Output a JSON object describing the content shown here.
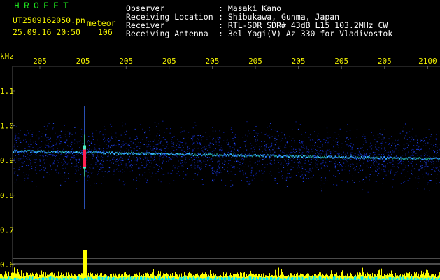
{
  "header": {
    "logo": "HROFFT",
    "filename": "UT2509162050.pn",
    "mode": "meteor",
    "datetime": "25.09.16 20:50",
    "count": "106",
    "info_labels": [
      "Observer",
      "Receiving Location",
      "Receiver",
      "Receiving Antenna"
    ],
    "info_values": [
      ": Masaki Kano",
      ": Shibukawa, Gunma, Japan",
      ": RTL-SDR SDR# 43dB L15 103.2MHz CW",
      ": 3el Yagi(V) Az 330 for Vladivostok"
    ]
  },
  "axis": {
    "unit": "kHz",
    "y_ticks": [
      "1.1",
      "1.0",
      "0.9",
      "0.8",
      "0.7",
      "0.6"
    ],
    "x_ticks": [
      "205",
      "205",
      "205",
      "205",
      "205",
      "205",
      "205",
      "205",
      "205",
      "2100"
    ]
  },
  "colors": {
    "background": "#000000",
    "axis_text": "#f0f000",
    "logo": "#1ee01e",
    "trace": "#2060ff",
    "echo": "#ff2050",
    "histogram_yellow": "#ffff00",
    "histogram_cyan": "#00e8ff"
  }
}
